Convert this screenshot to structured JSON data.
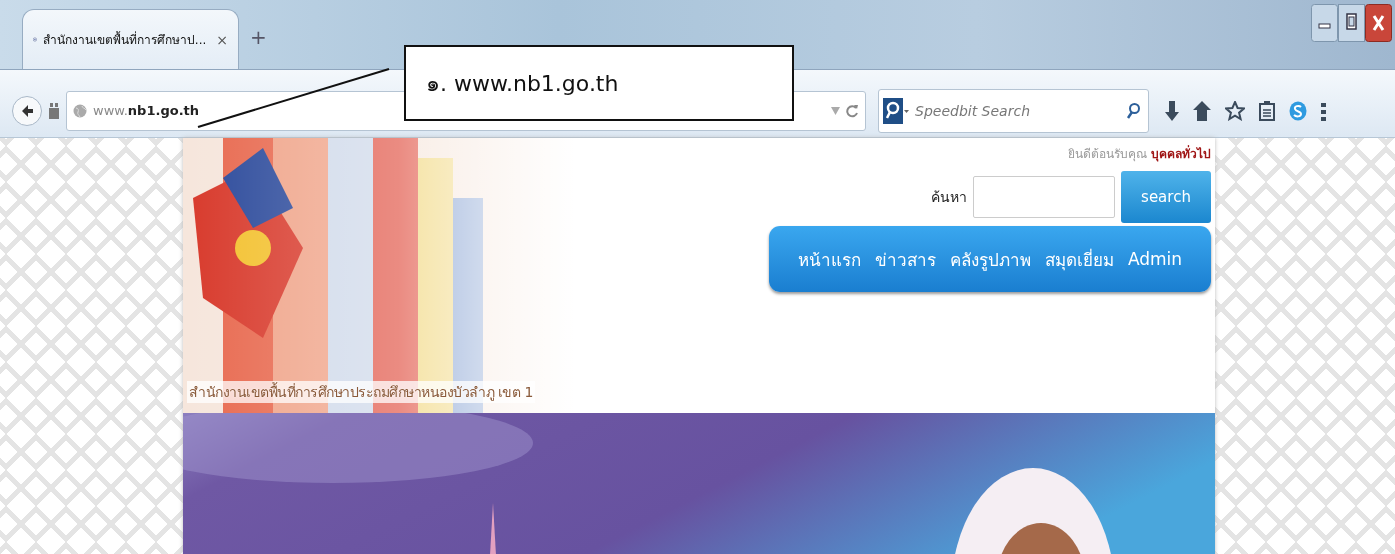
{
  "browser": {
    "tab": {
      "title": "สำนักงานเขตพื้นที่การศึกษาป...",
      "close": "×"
    },
    "new_tab": "+",
    "address": "www.**nb1.go.th**",
    "search": {
      "placeholder": "Speedbit Search"
    }
  },
  "callout": {
    "text": "๑. www.nb1.go.th"
  },
  "site": {
    "welcome": "ยินดีต้อนรับคุณ **บุคคลทั่วไป**",
    "search_label": "ค้นหา",
    "search_button": "search",
    "nav": [
      "หน้าแรก",
      "ข่าวสาร",
      "คลังรูปภาพ",
      "สมุดเยี่ยม",
      "Admin"
    ],
    "banner_title": "สำนักงานเขตพื้นที่การศึกษาประถมศึกษาหนองบัวลำภู เขต 1"
  }
}
